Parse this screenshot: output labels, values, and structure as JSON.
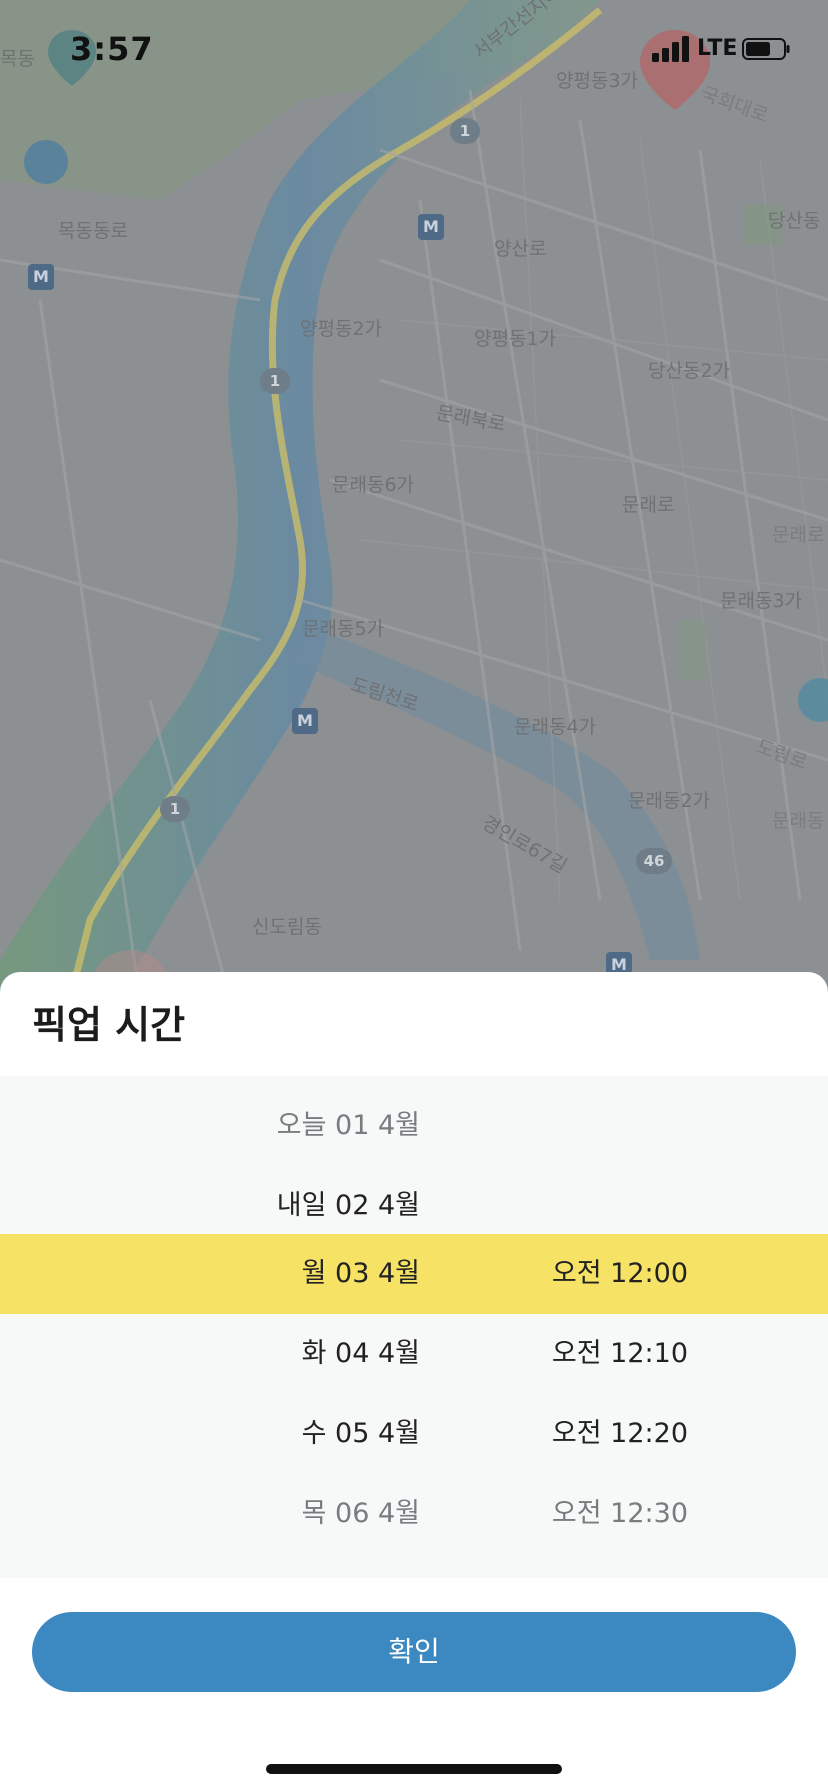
{
  "status_bar": {
    "time": "3:57",
    "network": "LTE"
  },
  "map": {
    "labels": [
      "목동",
      "양평동3가",
      "서부간선지하도로",
      "목동동로",
      "양산로",
      "당산동",
      "양평동2가",
      "양평동1가",
      "당산동2가",
      "문래북로",
      "문래동6가",
      "문래로",
      "문래동3가",
      "문래동5가",
      "도림천로",
      "문래동4가",
      "문래동2가",
      "경인로67길",
      "신도림동",
      "국회대로",
      "문래로",
      "도림로",
      "문래동"
    ],
    "road_badges": [
      "1",
      "1",
      "1",
      "46"
    ],
    "metro_symbol": "M"
  },
  "sheet": {
    "title": "픽업 시간",
    "rows": [
      {
        "date": "오늘 01 4월",
        "time": ""
      },
      {
        "date": "내일 02 4월",
        "time": ""
      },
      {
        "date": "월 03 4월",
        "time": "오전 12:00"
      },
      {
        "date": "화 04 4월",
        "time": "오전 12:10"
      },
      {
        "date": "수 05 4월",
        "time": "오전 12:20"
      },
      {
        "date": "목 06 4월",
        "time": "오전 12:30"
      }
    ],
    "confirm_label": "확인"
  },
  "colors": {
    "selected_row": "#f6e264",
    "confirm_button": "#3c88c0"
  }
}
